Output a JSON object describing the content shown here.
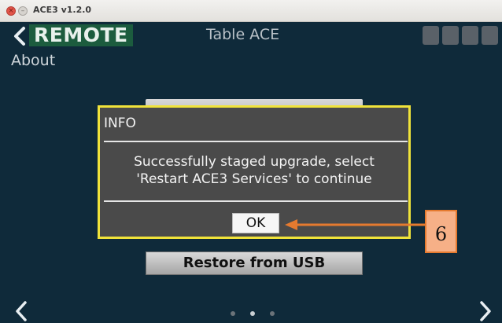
{
  "window": {
    "title": "ACE3 v1.2.0"
  },
  "header": {
    "mode_label": "REMOTE",
    "title": "Table ACE",
    "tiles": 4
  },
  "section": {
    "title": "About"
  },
  "buttons": {
    "restore_label": "Restore from USB"
  },
  "dialog": {
    "title": "INFO",
    "message_line1": "Successfully staged upgrade, select",
    "message_line2": "'Restart ACE3 Services' to continue",
    "ok_label": "OK"
  },
  "pager": {
    "count": 3,
    "active_index": 1
  },
  "callout": {
    "number": "6"
  },
  "colors": {
    "app_bg": "#0f2a3a",
    "remote_bg": "#1c5c3e",
    "dialog_border": "#f0e33a",
    "callout_fill": "#f6b087",
    "callout_border": "#e57a2f"
  }
}
